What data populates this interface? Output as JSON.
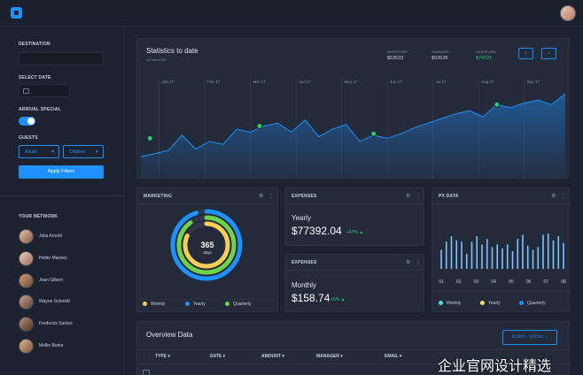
{
  "sidebar": {
    "destination_label": "DESTINATION",
    "select_date_label": "SELECT DATE",
    "arrival_label": "ARRIVAL SPECIAL",
    "guests_label": "GUESTS",
    "adults": "Adults",
    "children": "Children",
    "apply": "Apply Filters",
    "network_label": "YOUR NETWORK",
    "network": [
      "Julia Arnold",
      "Hettie Massey",
      "Jean Gilbert",
      "Wayne Schmidt",
      "Frederick Santos",
      "Mollie Burke"
    ]
  },
  "stats": {
    "title": "Statistics to date",
    "date": "12 Jan 2018",
    "items": [
      {
        "label": "INVENTORY",
        "value": "$53533",
        "color": "#c9d2e3"
      },
      {
        "label": "SUMMARY",
        "value": "$93528",
        "color": "#c9d2e3"
      },
      {
        "label": "CASHFLOW",
        "value": "$74721",
        "color": "#2ecc71"
      }
    ],
    "prev_icon": "‹",
    "next_icon": "›"
  },
  "chart_data": [
    {
      "type": "area",
      "title": "Statistics to date",
      "categories": [
        "Jan 17",
        "Feb 17",
        "Mar 17",
        "Apr 17",
        "May 17",
        "Jun 17",
        "Jul 17",
        "Aug 17",
        "Sep 17"
      ],
      "x": [
        0,
        0.3,
        0.6,
        0.9,
        1.2,
        1.5,
        1.8,
        2.1,
        2.4,
        2.7,
        3.0,
        3.3,
        3.6,
        3.9,
        4.2,
        4.5,
        4.8,
        5.1,
        5.4,
        5.7,
        6.0,
        6.3,
        6.6,
        6.9,
        7.2,
        7.5,
        7.8,
        8.1,
        8.4,
        8.7,
        9.0,
        9.3
      ],
      "values": [
        12,
        14,
        16,
        26,
        17,
        22,
        20,
        30,
        28,
        32,
        34,
        28,
        36,
        25,
        30,
        33,
        22,
        26,
        24,
        27,
        31,
        34,
        37,
        40,
        42,
        38,
        46,
        44,
        47,
        49,
        46,
        53
      ],
      "highlighted_points": [
        {
          "x": 0.2,
          "y": 24
        },
        {
          "x": 2.6,
          "y": 32
        },
        {
          "x": 5.1,
          "y": 27
        },
        {
          "x": 7.8,
          "y": 46
        }
      ],
      "ylim": [
        0,
        60
      ]
    },
    {
      "type": "pie",
      "title": "MARKETING",
      "center_value": "365",
      "center_label": "days",
      "series": [
        {
          "name": "Weekly",
          "value": 0.82,
          "color": "#f6cf57"
        },
        {
          "name": "Quarterly",
          "value": 0.9,
          "color": "#6fd24b"
        },
        {
          "name": "Yearly",
          "value": 0.95,
          "color": "#1e90ff"
        }
      ]
    },
    {
      "type": "bar",
      "title": "PX DATA",
      "categories": [
        "01",
        "02",
        "03",
        "04",
        "05",
        "06",
        "07",
        "08"
      ],
      "values": [
        14,
        20,
        24,
        21,
        20,
        11,
        20,
        24,
        18,
        22,
        16,
        18,
        15,
        18,
        13,
        22,
        25,
        17,
        14,
        16,
        25,
        26,
        21,
        24,
        19
      ]
    }
  ],
  "expenses1": {
    "title": "EXPENSES",
    "period": "Yearly",
    "value": "$77392.04",
    "change": "+47%"
  },
  "expenses2": {
    "title": "EXPENSES",
    "period": "Monthly",
    "value": "$158.74",
    "change": "+5%"
  },
  "marketing": {
    "legend": [
      {
        "label": "Weekly",
        "color": "#f6cf57"
      },
      {
        "label": "Yearly",
        "color": "#1e90ff"
      },
      {
        "label": "Quarterly",
        "color": "#6fd24b"
      }
    ]
  },
  "pxdata": {
    "legend": [
      {
        "label": "Weekly",
        "color": "#4de0d2"
      },
      {
        "label": "Yearly",
        "color": "#f6e05c"
      },
      {
        "label": "Quarterly",
        "color": "#1e90ff"
      }
    ]
  },
  "overview": {
    "title": "Overview Data",
    "range": "11 Nov - 10 Dec",
    "columns": [
      "TYPE",
      "DATE",
      "AMOUNT",
      "MANAGER",
      "EMAIL"
    ]
  },
  "watermark": "企业官网设计精选",
  "colors": {
    "accent": "#1e90ff",
    "bg": "#1c2230",
    "panel": "#232a39",
    "positive": "#2ecc71"
  }
}
